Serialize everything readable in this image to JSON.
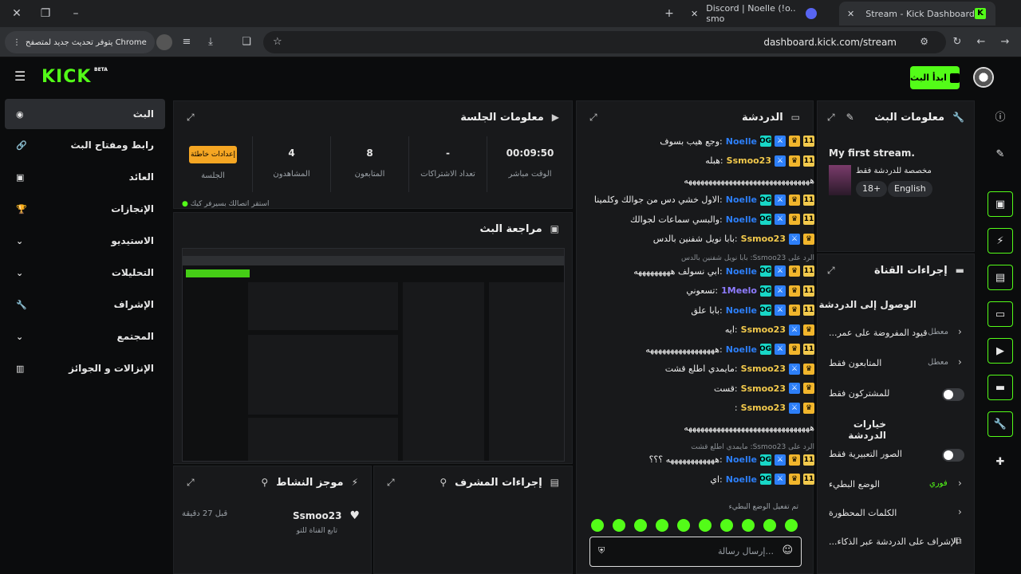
{
  "browser": {
    "tabs": [
      {
        "title": "Stream - Kick Dashboard",
        "active": true
      },
      {
        "title": "Discord | Noelle (!o.. smo",
        "active": false
      }
    ],
    "update_chip": "يتوفر تحديث جديد لمتصفح Chrome",
    "url": "dashboard.kick.com/stream"
  },
  "header": {
    "logo": "KICK",
    "beta": "BETA",
    "go_live": "ابدأ البث"
  },
  "nav": {
    "items": [
      {
        "label": "البث",
        "icon": "broadcast-icon"
      },
      {
        "label": "رابط ومفتاح البث",
        "icon": "link-icon"
      },
      {
        "label": "العائد",
        "icon": "revenue-icon"
      },
      {
        "label": "الإنجازات",
        "icon": "trophy-icon"
      },
      {
        "label": "الاستيديو",
        "icon": "studio-icon"
      },
      {
        "label": "التحليلات",
        "icon": "analytics-icon"
      },
      {
        "label": "الإشراف",
        "icon": "wrench-icon"
      },
      {
        "label": "المجتمع",
        "icon": "community-icon"
      },
      {
        "label": "الإنزالات و الجوائز",
        "icon": "drops-icon"
      }
    ]
  },
  "session": {
    "title": "معلومات الجلسة",
    "stats": [
      {
        "value": "00:09:50",
        "label": "الوقت مباشر"
      },
      {
        "value": "-",
        "label": "تعداد الاشتراكات"
      },
      {
        "value": "8",
        "label": "المتابعون"
      },
      {
        "value": "4",
        "label": "المشاهدون"
      }
    ],
    "warning_btn": "إعدادات خاطئة",
    "warning_label": "الجلسة",
    "footer": "استقر اتصالك بسيرفر كيك"
  },
  "preview": {
    "title": "مراجعة البث"
  },
  "activity": {
    "title": "موجز النشاط",
    "user": "Ssmoo23",
    "time": "قبل 27 دقيقة",
    "text": "تابع القناة للتو"
  },
  "modactions": {
    "title": "إجراءات المشرف"
  },
  "chat": {
    "title": "الدردشة",
    "messages": [
      {
        "user": "Noelle",
        "color": "#2d7ff9",
        "badges": [
          "sub",
          "crown",
          "mod",
          "og"
        ],
        "text": "وجع هيب بسوف"
      },
      {
        "user": "Ssmoo23",
        "color": "#f2c94c",
        "badges": [
          "sub",
          "crown",
          "mod"
        ],
        "text": "هبله"
      },
      {
        "user": "",
        "color": "#f0f0f0",
        "badges": [],
        "text": "هههههههههههههههههههههههههههههههه"
      },
      {
        "user": "Noelle",
        "color": "#2d7ff9",
        "badges": [
          "sub",
          "crown",
          "mod",
          "og"
        ],
        "text": "الاول خشي دس من جوالك وكلمينا"
      },
      {
        "user": "Noelle",
        "color": "#2d7ff9",
        "badges": [
          "sub",
          "crown",
          "mod",
          "og"
        ],
        "text": "والبسي سماعات لجوالك"
      },
      {
        "user": "Ssmoo23",
        "color": "#f2c94c",
        "badges": [
          "crown",
          "mod"
        ],
        "text": "بابا نويل شفنين بالدس"
      },
      {
        "user": "",
        "color": "#8a8f94",
        "badges": [],
        "text": "الرد على Ssmoo23: بابا نويل شفنين بالدس"
      },
      {
        "user": "Noelle",
        "color": "#2d7ff9",
        "badges": [
          "sub",
          "crown",
          "mod",
          "og"
        ],
        "text": "ابي نسولف هههههههههه"
      },
      {
        "user": "1Meelo",
        "color": "#8e7cff",
        "badges": [
          "sub",
          "crown",
          "mod",
          "og"
        ],
        "text": "تسعوني"
      },
      {
        "user": "Noelle",
        "color": "#2d7ff9",
        "badges": [
          "sub",
          "crown",
          "mod",
          "og"
        ],
        "text": "بابا علق"
      },
      {
        "user": "Ssmoo23",
        "color": "#f2c94c",
        "badges": [
          "crown",
          "mod"
        ],
        "text": "ايه"
      },
      {
        "user": "Noelle",
        "color": "#2d7ff9",
        "badges": [
          "sub",
          "crown",
          "mod",
          "og"
        ],
        "text": "هههههههههههههههههه"
      },
      {
        "user": "Ssmoo23",
        "color": "#f2c94c",
        "badges": [
          "crown",
          "mod"
        ],
        "text": "مايمدي اطلع قشت"
      },
      {
        "user": "Ssmoo23",
        "color": "#f2c94c",
        "badges": [
          "crown",
          "mod"
        ],
        "text": "قست"
      },
      {
        "user": "Ssmoo23",
        "color": "#f2c94c",
        "badges": [
          "crown",
          "mod"
        ],
        "text": ""
      },
      {
        "user": "",
        "color": "#f0f0f0",
        "badges": [],
        "text": "هههههههههههههههههههههههههههههههه"
      },
      {
        "user": "",
        "color": "#8a8f94",
        "badges": [],
        "text": "الرد على Ssmoo23: مايمدي اطلع قشت"
      },
      {
        "user": "Noelle",
        "color": "#2d7ff9",
        "badges": [
          "sub",
          "crown",
          "mod",
          "og"
        ],
        "text": "ههههههههههههه ؟؟؟"
      },
      {
        "user": "Noelle",
        "color": "#2d7ff9",
        "badges": [
          "sub",
          "crown",
          "mod",
          "og"
        ],
        "text": "اي"
      }
    ],
    "slowmode_note": "تم تفعيل الوضع البطيء",
    "input_placeholder": "إرسال رسالة..."
  },
  "streaminfo": {
    "title": "معلومات البث",
    "stream_title": "My first stream.",
    "category": "مخصصة للدردشة فقط",
    "tags": [
      "18+",
      "English"
    ]
  },
  "channel": {
    "title": "إجراءات القناة",
    "access_title": "الوصول إلى الدردشة",
    "rows": [
      {
        "label": "قيود المفروضة على عمر...",
        "value": "معطل"
      },
      {
        "label": "المتابعون فقط",
        "value": "معطل"
      },
      {
        "label": "للمشتركون فقط",
        "value": ""
      }
    ],
    "options_title": "خيارات الدردشة",
    "options": [
      {
        "label": "الصور التعبيرية فقط",
        "value": ""
      },
      {
        "label": "الوضع البطيء",
        "value": "فوري"
      },
      {
        "label": "الكلمات المحظورة",
        "value": ""
      },
      {
        "label": "الإشراف على الدردشة عبر الذكاء...",
        "value": ""
      }
    ],
    "accent": "#53fc18"
  }
}
